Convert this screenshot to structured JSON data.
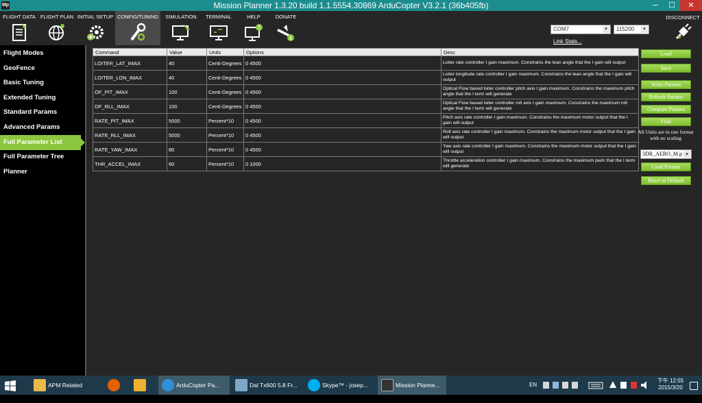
{
  "window": {
    "title": "Mission Planner 1.3.20 build 1.1.5554.30869 ArduCopter V3.2.1 (36b405fb)",
    "app_icon_text": "Mp",
    "minimize": "─",
    "maximize": "☐",
    "close": "✕"
  },
  "toolbar": {
    "nav": [
      {
        "label": "FLIGHT DATA",
        "icon": "clipboard-icon"
      },
      {
        "label": "FLIGHT PLAN",
        "icon": "globe-icon"
      },
      {
        "label": "INITIAL SETUP",
        "icon": "gear-plus-icon"
      },
      {
        "label": "CONFIG/TUNING",
        "icon": "wrench-icon"
      },
      {
        "label": "SIMULATION",
        "icon": "monitor-plane-icon"
      },
      {
        "label": "TERMINAL",
        "icon": "terminal-icon"
      },
      {
        "label": "HELP",
        "icon": "monitor-help-icon"
      },
      {
        "label": "DONATE",
        "icon": "plane-dollar-icon"
      }
    ],
    "com_port": "COM7",
    "baud_rate": "115200",
    "dropdown_arrow": "▾",
    "link_stats": "Link Stats...",
    "disconnect": "DISCONNECT"
  },
  "sidebar": {
    "items": [
      {
        "label": "Flight Modes"
      },
      {
        "label": "GeoFence"
      },
      {
        "label": "Basic Tuning"
      },
      {
        "label": "Extended Tuning"
      },
      {
        "label": "Standard Params"
      },
      {
        "label": "Advanced Params"
      },
      {
        "label": "Full Parameter List"
      },
      {
        "label": "Full Parameter Tree"
      },
      {
        "label": "Planner"
      }
    ],
    "active_index": 6
  },
  "table": {
    "headers": [
      "Command",
      "Value",
      "Units",
      "Options",
      "Desc"
    ],
    "rows": [
      [
        "LOITER_LAT_IMAX",
        "40",
        "Centi-Degrees",
        "0 4500",
        "Loiter rate controller I gain maximum.  Constrains the lean angle that the I gain will output"
      ],
      [
        "LOITER_LON_IMAX",
        "40",
        "Centi-Degrees",
        "0 4500",
        "Loiter longitude rate controller I gain maximum.  Constrains the lean angle that the I gain will output"
      ],
      [
        "OF_PIT_IMAX",
        "100",
        "Centi-Degrees",
        "0 4500",
        "Optical Flow based loiter controller pitch axis I gain maximum.  Constrains the maximum pitch angle that the I term will generate"
      ],
      [
        "OF_RLL_IMAX",
        "100",
        "Centi-Degrees",
        "0 4500",
        "Optical Flow based loiter controller roll axis I gain maximum.  Constrains the maximum roll angle that the I term will generate"
      ],
      [
        "RATE_PIT_IMAX",
        "5000",
        "Percent*10",
        "0 4500",
        "Pitch axis rate controller I gain maximum.  Constrains the maximum motor output that the I gain will output"
      ],
      [
        "RATE_RLL_IMAX",
        "5000",
        "Percent*10",
        "0 4500",
        "Roll axis rate controller I gain maximum.  Constrains the maximum motor output that the I gain will output"
      ],
      [
        "RATE_YAW_IMAX",
        "80",
        "Percent*10",
        "0 4500",
        "Yaw axis rate controller I gain maximum.  Constrains the maximum motor output that the I gain will output"
      ],
      [
        "THR_ACCEL_IMAX",
        "60",
        "Percent*10",
        "0 1000",
        "Throttle acceleration controller I gain maximum.  Constrains the maximum pwm that the I term will generate"
      ]
    ]
  },
  "actions": {
    "load": "Load",
    "save": "Save",
    "write_params": "Write Params",
    "refresh_params": "Refresh Params",
    "compare_params": "Compare Params",
    "find": "Find",
    "units_note": "All Units are in raw format with no scaling",
    "param_file": "3DR_AERO_M.p",
    "load_params": "Load Params",
    "reset_default": "Reset to Default"
  },
  "taskbar": {
    "tasks": [
      {
        "label": "APM Related"
      },
      {
        "label": ""
      },
      {
        "label": ""
      },
      {
        "label": "ArduCopter Pa..."
      },
      {
        "label": "Dal Tx600 5.8 Fr..."
      },
      {
        "label": "Skype™ - josep..."
      },
      {
        "label": "Mission Planne..."
      }
    ],
    "lang": "EN",
    "time": "下午 12:55",
    "date": "2015/3/20"
  },
  "colors": {
    "accent_green": "#8dc63f",
    "titlebar": "#1c8d8e",
    "close_red": "#c7372f"
  }
}
